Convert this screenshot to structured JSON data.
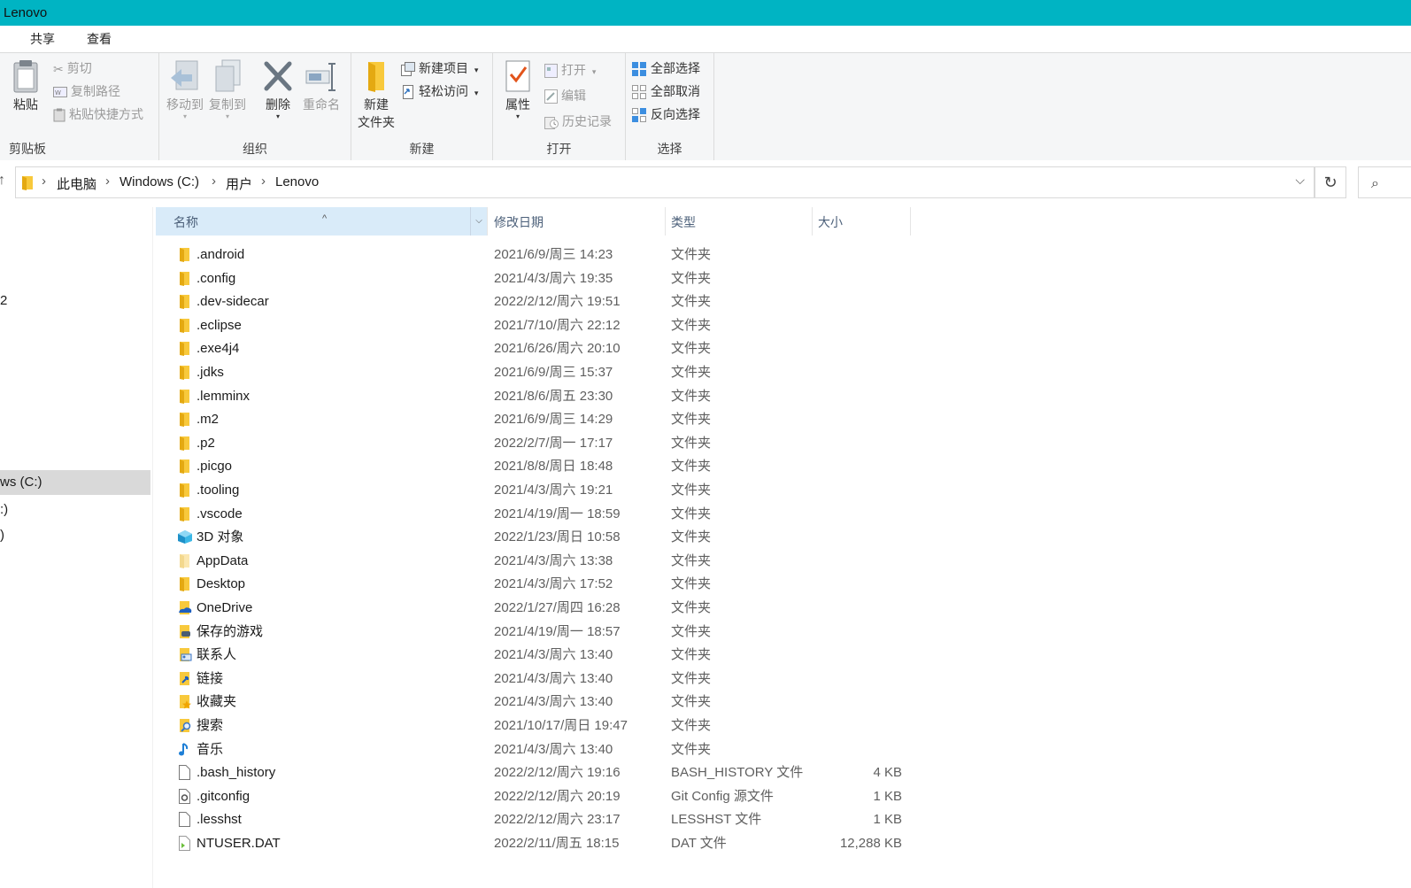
{
  "window": {
    "title": "Lenovo"
  },
  "ribbon_tabs": [
    "共享",
    "查看"
  ],
  "ribbon": {
    "clipboard": {
      "label": "剪贴板",
      "paste": "粘贴",
      "cut": "剪切",
      "copy_path": "复制路径",
      "paste_shortcut": "粘贴快捷方式"
    },
    "organize": {
      "label": "组织",
      "move_to": "移动到",
      "copy_to": "复制到",
      "delete": "删除",
      "rename": "重命名"
    },
    "new": {
      "label": "新建",
      "new_folder_line1": "新建",
      "new_folder_line2": "文件夹",
      "new_item": "新建项目",
      "easy_access": "轻松访问"
    },
    "open": {
      "label": "打开",
      "properties": "属性",
      "open": "打开",
      "edit": "编辑",
      "history": "历史记录"
    },
    "select": {
      "label": "选择",
      "select_all": "全部选择",
      "select_none": "全部取消",
      "invert": "反向选择"
    }
  },
  "address": {
    "crumbs": [
      "此电脑",
      "Windows (C:)",
      "用户",
      "Lenovo"
    ]
  },
  "nav": {
    "items": [
      {
        "label": "2"
      },
      {
        "label": "ws (C:)",
        "selected": true
      },
      {
        "label": ":)"
      },
      {
        "label": ")"
      }
    ]
  },
  "columns": {
    "name": "名称",
    "date": "修改日期",
    "type": "类型",
    "size": "大小"
  },
  "rows": [
    {
      "name": ".android",
      "date": "2021/6/9/周三 14:23",
      "type": "文件夹",
      "size": "",
      "icon": "folder-icon"
    },
    {
      "name": ".config",
      "date": "2021/4/3/周六 19:35",
      "type": "文件夹",
      "size": "",
      "icon": "folder-icon"
    },
    {
      "name": ".dev-sidecar",
      "date": "2022/2/12/周六 19:51",
      "type": "文件夹",
      "size": "",
      "icon": "folder-icon"
    },
    {
      "name": ".eclipse",
      "date": "2021/7/10/周六 22:12",
      "type": "文件夹",
      "size": "",
      "icon": "folder-icon"
    },
    {
      "name": ".exe4j4",
      "date": "2021/6/26/周六 20:10",
      "type": "文件夹",
      "size": "",
      "icon": "folder-icon"
    },
    {
      "name": ".jdks",
      "date": "2021/6/9/周三 15:37",
      "type": "文件夹",
      "size": "",
      "icon": "folder-icon"
    },
    {
      "name": ".lemminx",
      "date": "2021/8/6/周五 23:30",
      "type": "文件夹",
      "size": "",
      "icon": "folder-icon"
    },
    {
      "name": ".m2",
      "date": "2021/6/9/周三 14:29",
      "type": "文件夹",
      "size": "",
      "icon": "folder-icon"
    },
    {
      "name": ".p2",
      "date": "2022/2/7/周一 17:17",
      "type": "文件夹",
      "size": "",
      "icon": "folder-icon"
    },
    {
      "name": ".picgo",
      "date": "2021/8/8/周日 18:48",
      "type": "文件夹",
      "size": "",
      "icon": "folder-icon"
    },
    {
      "name": ".tooling",
      "date": "2021/4/3/周六 19:21",
      "type": "文件夹",
      "size": "",
      "icon": "folder-icon"
    },
    {
      "name": ".vscode",
      "date": "2021/4/19/周一 18:59",
      "type": "文件夹",
      "size": "",
      "icon": "folder-icon"
    },
    {
      "name": "3D 对象",
      "date": "2022/1/23/周日 10:58",
      "type": "文件夹",
      "size": "",
      "icon": "3d-objects-icon"
    },
    {
      "name": "AppData",
      "date": "2021/4/3/周六 13:38",
      "type": "文件夹",
      "size": "",
      "icon": "hidden-folder-icon"
    },
    {
      "name": "Desktop",
      "date": "2021/4/3/周六 17:52",
      "type": "文件夹",
      "size": "",
      "icon": "folder-icon"
    },
    {
      "name": "OneDrive",
      "date": "2022/1/27/周四 16:28",
      "type": "文件夹",
      "size": "",
      "icon": "onedrive-folder-icon"
    },
    {
      "name": "保存的游戏",
      "date": "2021/4/19/周一 18:57",
      "type": "文件夹",
      "size": "",
      "icon": "saved-games-icon"
    },
    {
      "name": "联系人",
      "date": "2021/4/3/周六 13:40",
      "type": "文件夹",
      "size": "",
      "icon": "contacts-icon"
    },
    {
      "name": "链接",
      "date": "2021/4/3/周六 13:40",
      "type": "文件夹",
      "size": "",
      "icon": "links-icon"
    },
    {
      "name": "收藏夹",
      "date": "2021/4/3/周六 13:40",
      "type": "文件夹",
      "size": "",
      "icon": "favorites-icon"
    },
    {
      "name": "搜索",
      "date": "2021/10/17/周日 19:47",
      "type": "文件夹",
      "size": "",
      "icon": "searches-icon"
    },
    {
      "name": "音乐",
      "date": "2021/4/3/周六 13:40",
      "type": "文件夹",
      "size": "",
      "icon": "music-icon"
    },
    {
      "name": ".bash_history",
      "date": "2022/2/12/周六 19:16",
      "type": "BASH_HISTORY 文件",
      "size": "4 KB",
      "icon": "file-icon"
    },
    {
      "name": ".gitconfig",
      "date": "2022/2/12/周六 20:19",
      "type": "Git Config 源文件",
      "size": "1 KB",
      "icon": "config-file-icon"
    },
    {
      "name": ".lesshst",
      "date": "2022/2/12/周六 23:17",
      "type": "LESSHST 文件",
      "size": "1 KB",
      "icon": "file-icon"
    },
    {
      "name": "NTUSER.DAT",
      "date": "2022/2/11/周五 18:15",
      "type": "DAT 文件",
      "size": "12,288 KB",
      "icon": "dat-file-icon"
    }
  ],
  "colors": {
    "titlebar": "#00b4c3",
    "folder": "#f8c93c",
    "sorted_header": "#d9ebf9",
    "selected_nav": "#d9d9d9"
  }
}
